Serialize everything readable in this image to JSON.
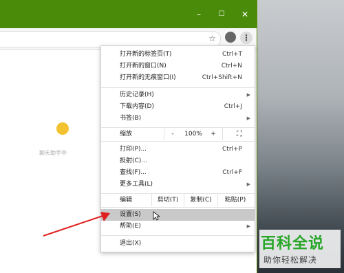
{
  "window": {
    "minimize": "–",
    "maximize": "☐",
    "close": "✕"
  },
  "toolbar": {
    "star": "☆",
    "menu": "⋮"
  },
  "extension": {
    "label": "聊天助手中"
  },
  "menu": {
    "items": [
      {
        "label": "打开新的标签页(T)",
        "shortcut": "Ctrl+T"
      },
      {
        "label": "打开新的窗口(N)",
        "shortcut": "Ctrl+N"
      },
      {
        "label": "打开新的无痕窗口(I)",
        "shortcut": "Ctrl+Shift+N"
      },
      {
        "label": "历史记录(H)",
        "shortcut": ""
      },
      {
        "label": "下载内容(D)",
        "shortcut": "Ctrl+J"
      },
      {
        "label": "书签(B)",
        "shortcut": ""
      },
      {
        "label": "打印(P)...",
        "shortcut": "Ctrl+P"
      },
      {
        "label": "投射(C)...",
        "shortcut": ""
      },
      {
        "label": "查找(F)...",
        "shortcut": "Ctrl+F"
      },
      {
        "label": "更多工具(L)",
        "shortcut": ""
      },
      {
        "label": "设置(S)",
        "shortcut": ""
      },
      {
        "label": "帮助(E)",
        "shortcut": ""
      },
      {
        "label": "退出(X)",
        "shortcut": ""
      }
    ],
    "zoom": {
      "label": "缩放",
      "minus": "-",
      "value": "100%",
      "plus": "+",
      "fullscreen": "⛶"
    },
    "edit": {
      "label": "编辑",
      "cut": "剪切(T)",
      "copy": "复制(C)",
      "paste": "粘贴(P)"
    }
  },
  "watermark": {
    "title": "百科全说",
    "subtitle": "助你轻松解决"
  },
  "colors": {
    "titlebar": "#4a8c0a",
    "highlight": "#c9c9c9",
    "arrow": "#e02020"
  }
}
